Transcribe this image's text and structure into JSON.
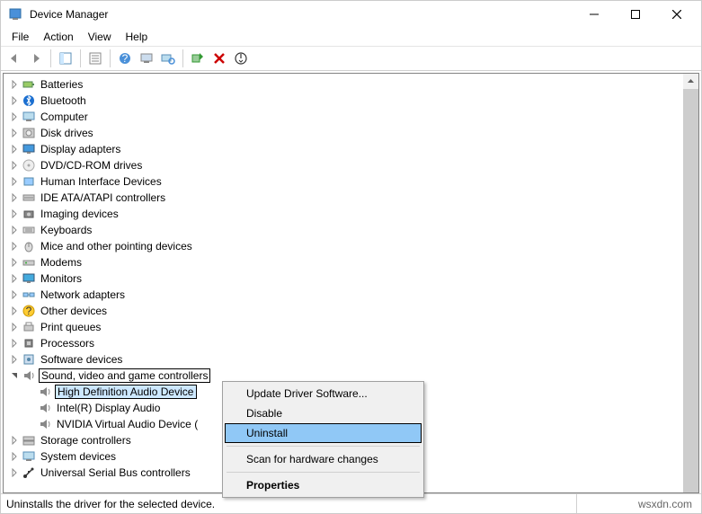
{
  "window": {
    "title": "Device Manager"
  },
  "menu": {
    "file": "File",
    "action": "Action",
    "view": "View",
    "help": "Help"
  },
  "tree": {
    "items": [
      {
        "label": "Batteries",
        "expanded": false,
        "icon": "battery"
      },
      {
        "label": "Bluetooth",
        "expanded": false,
        "icon": "bluetooth"
      },
      {
        "label": "Computer",
        "expanded": false,
        "icon": "computer"
      },
      {
        "label": "Disk drives",
        "expanded": false,
        "icon": "disk"
      },
      {
        "label": "Display adapters",
        "expanded": false,
        "icon": "display"
      },
      {
        "label": "DVD/CD-ROM drives",
        "expanded": false,
        "icon": "cd"
      },
      {
        "label": "Human Interface Devices",
        "expanded": false,
        "icon": "hid"
      },
      {
        "label": "IDE ATA/ATAPI controllers",
        "expanded": false,
        "icon": "ide"
      },
      {
        "label": "Imaging devices",
        "expanded": false,
        "icon": "camera"
      },
      {
        "label": "Keyboards",
        "expanded": false,
        "icon": "keyboard"
      },
      {
        "label": "Mice and other pointing devices",
        "expanded": false,
        "icon": "mouse"
      },
      {
        "label": "Modems",
        "expanded": false,
        "icon": "modem"
      },
      {
        "label": "Monitors",
        "expanded": false,
        "icon": "monitor"
      },
      {
        "label": "Network adapters",
        "expanded": false,
        "icon": "network"
      },
      {
        "label": "Other devices",
        "expanded": false,
        "icon": "unknown"
      },
      {
        "label": "Print queues",
        "expanded": false,
        "icon": "printer"
      },
      {
        "label": "Processors",
        "expanded": false,
        "icon": "cpu"
      },
      {
        "label": "Software devices",
        "expanded": false,
        "icon": "software"
      },
      {
        "label": "Sound, video and game controllers",
        "expanded": true,
        "boxed": true,
        "icon": "speaker",
        "children": [
          {
            "label": "High Definition Audio Device",
            "selected": true,
            "icon": "speaker"
          },
          {
            "label": "Intel(R) Display Audio",
            "icon": "speaker"
          },
          {
            "label": "NVIDIA Virtual Audio Device (",
            "icon": "speaker"
          }
        ]
      },
      {
        "label": "Storage controllers",
        "expanded": false,
        "icon": "storage"
      },
      {
        "label": "System devices",
        "expanded": false,
        "icon": "system"
      },
      {
        "label": "Universal Serial Bus controllers",
        "expanded": false,
        "icon": "usb"
      }
    ]
  },
  "context_menu": {
    "items": [
      {
        "label": "Update Driver Software..."
      },
      {
        "label": "Disable"
      },
      {
        "label": "Uninstall",
        "highlight": true
      },
      {
        "sep": true
      },
      {
        "label": "Scan for hardware changes"
      },
      {
        "sep": true
      },
      {
        "label": "Properties",
        "bold": true
      }
    ]
  },
  "status": {
    "text": "Uninstalls the driver for the selected device.",
    "watermark": "wsxdn.com"
  }
}
